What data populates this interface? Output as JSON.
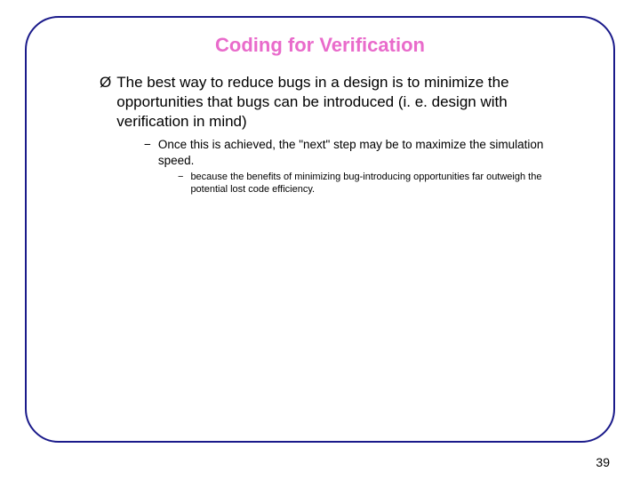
{
  "slide": {
    "title": "Coding for Verification",
    "bullets": {
      "l1": {
        "marker": "Ø",
        "text": "The best way to reduce bugs in a design is to minimize the opportunities that bugs can be introduced (i. e. design with verification in mind)"
      },
      "l2": {
        "marker": "−",
        "text": "Once this is achieved, the \"next\" step may be to maximize the simulation speed."
      },
      "l3": {
        "marker": "−",
        "text": "because the benefits of minimizing bug-introducing opportunities far outweigh the potential lost code efficiency."
      }
    },
    "page_number": "39"
  }
}
